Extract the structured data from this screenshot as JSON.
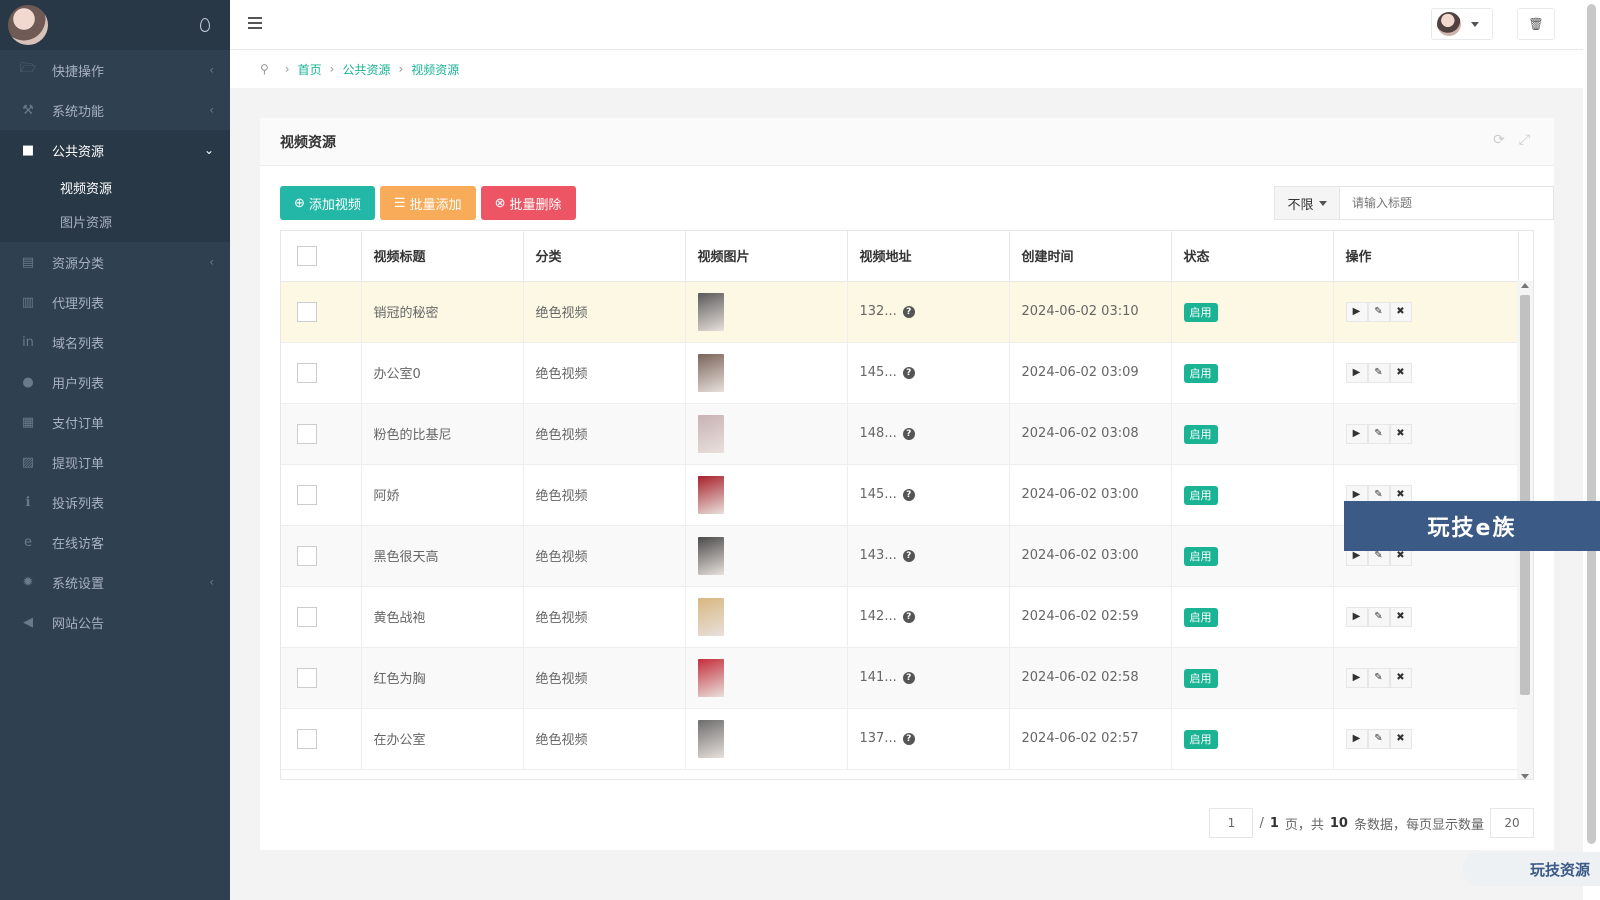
{
  "sidebar": {
    "items": [
      {
        "icon": "folder-icon",
        "glyph": "🗁",
        "label": "快捷操作",
        "arrow": "‹"
      },
      {
        "icon": "wrench-icon",
        "glyph": "⚒",
        "label": "系统功能",
        "arrow": "‹"
      },
      {
        "icon": "video-icon",
        "glyph": "■",
        "label": "公共资源",
        "arrow": "⌄"
      },
      {
        "icon": "tags-icon",
        "glyph": "▤",
        "label": "资源分类",
        "arrow": "‹"
      },
      {
        "icon": "shirt-icon",
        "glyph": "▥",
        "label": "代理列表",
        "arrow": ""
      },
      {
        "icon": "linkedin-icon",
        "glyph": "in",
        "label": "域名列表",
        "arrow": ""
      },
      {
        "icon": "user-icon",
        "glyph": "●",
        "label": "用户列表",
        "arrow": ""
      },
      {
        "icon": "database-icon",
        "glyph": "▦",
        "label": "支付订单",
        "arrow": ""
      },
      {
        "icon": "bank-icon",
        "glyph": "▨",
        "label": "提现订单",
        "arrow": ""
      },
      {
        "icon": "info-icon",
        "glyph": "ℹ",
        "label": "投诉列表",
        "arrow": ""
      },
      {
        "icon": "edge-icon",
        "glyph": "e",
        "label": "在线访客",
        "arrow": ""
      },
      {
        "icon": "gear-icon",
        "glyph": "✹",
        "label": "系统设置",
        "arrow": "‹"
      },
      {
        "icon": "bullhorn-icon",
        "glyph": "◀",
        "label": "网站公告",
        "arrow": ""
      }
    ],
    "sub_items": [
      "视频资源",
      "图片资源"
    ]
  },
  "breadcrumb": {
    "home": "首页",
    "section": "公共资源",
    "current": "视频资源"
  },
  "panel": {
    "title": "视频资源"
  },
  "toolbar": {
    "add": "添加视频",
    "batch_add": "批量添加",
    "batch_delete": "批量删除"
  },
  "search": {
    "filter": "不限",
    "placeholder": "请输入标题"
  },
  "table": {
    "headers": [
      "视频标题",
      "分类",
      "视频图片",
      "视频地址",
      "创建时间",
      "状态",
      "操作"
    ],
    "rows": [
      {
        "title": "销冠的秘密",
        "category": "绝色视频",
        "url": "132...",
        "time": "2024-06-02 03:10",
        "status": "启用",
        "thumb_color": "#5a5a5a"
      },
      {
        "title": "办公室0",
        "category": "绝色视频",
        "url": "145...",
        "time": "2024-06-02 03:09",
        "status": "启用",
        "thumb_color": "#7a6458"
      },
      {
        "title": "粉色的比基尼",
        "category": "绝色视频",
        "url": "148...",
        "time": "2024-06-02 03:08",
        "status": "启用",
        "thumb_color": "#c9b2b5"
      },
      {
        "title": "阿娇",
        "category": "绝色视频",
        "url": "145...",
        "time": "2024-06-02 03:00",
        "status": "启用",
        "thumb_color": "#a8202a"
      },
      {
        "title": "黑色很天高",
        "category": "绝色视频",
        "url": "143...",
        "time": "2024-06-02 03:00",
        "status": "启用",
        "thumb_color": "#4a4a4a"
      },
      {
        "title": "黄色战袍",
        "category": "绝色视频",
        "url": "142...",
        "time": "2024-06-02 02:59",
        "status": "启用",
        "thumb_color": "#d8b780"
      },
      {
        "title": "红色为胸",
        "category": "绝色视频",
        "url": "141...",
        "time": "2024-06-02 02:58",
        "status": "启用",
        "thumb_color": "#c42d3a"
      },
      {
        "title": "在办公室",
        "category": "绝色视频",
        "url": "137...",
        "time": "2024-06-02 02:57",
        "status": "启用",
        "thumb_color": "#6d6d6d"
      }
    ]
  },
  "pager": {
    "page": "1",
    "total_pages": "1",
    "pages_label": "页，共",
    "total": "10",
    "records_label": "条数据，每页显示数量",
    "page_size": "20"
  },
  "watermark": {
    "banner": "玩技e族",
    "corner": "玩技资源"
  },
  "colors": {
    "sidebar": "#2f4050",
    "accent": "#1ab394",
    "teal": "#23b7a7",
    "orange": "#f8ac59",
    "red": "#ed5565"
  }
}
